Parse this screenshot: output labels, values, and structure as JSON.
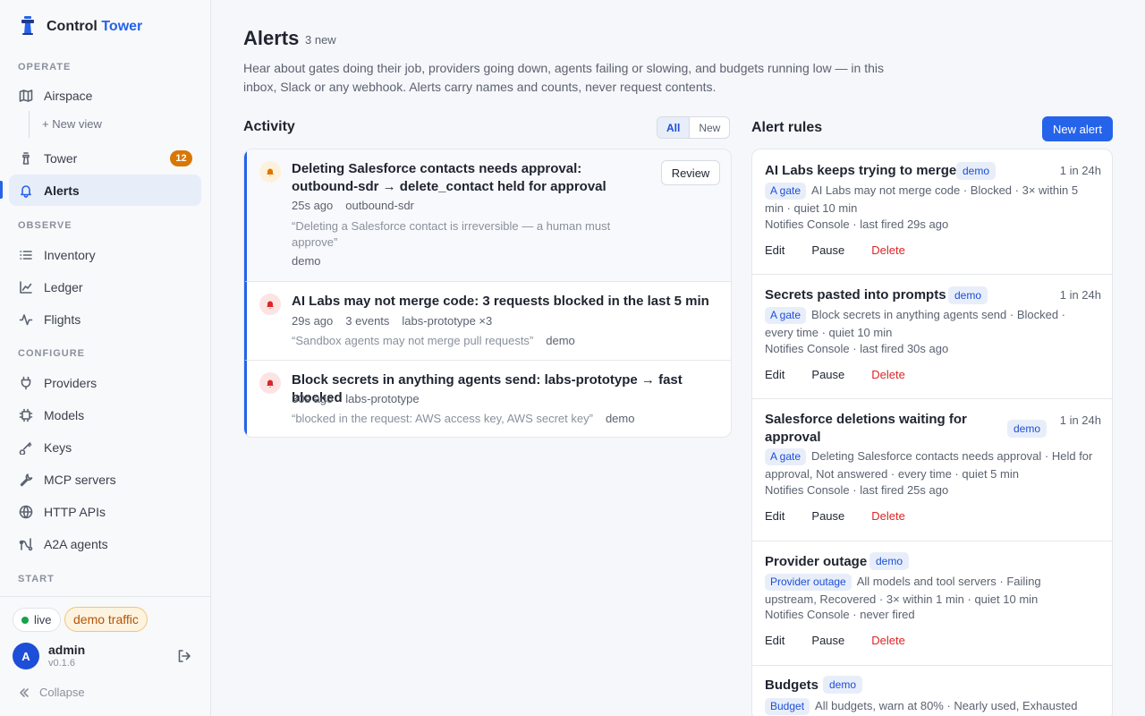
{
  "brand": {
    "name_a": "Control",
    "name_b": "Tower"
  },
  "sidebar": {
    "sections": {
      "operate": "OPERATE",
      "observe": "OBSERVE",
      "configure": "CONFIGURE",
      "start": "START"
    },
    "items": {
      "airspace": "Airspace",
      "new_view": "+ New view",
      "tower": "Tower",
      "tower_count": "12",
      "alerts": "Alerts",
      "inventory": "Inventory",
      "ledger": "Ledger",
      "flights": "Flights",
      "providers": "Providers",
      "models": "Models",
      "keys": "Keys",
      "mcp_servers": "MCP servers",
      "http_apis": "HTTP APIs",
      "a2a_agents": "A2A agents"
    },
    "status": {
      "live": "live",
      "demo": "demo traffic"
    },
    "user": {
      "initial": "A",
      "name": "admin",
      "version": "v0.1.6"
    },
    "collapse": "Collapse"
  },
  "page": {
    "title": "Alerts",
    "subtitle": "3 new",
    "description": "Hear about gates doing their job, providers going down, agents failing or slowing, and budgets running low — in this inbox, Slack or any webhook. Alerts carry names and counts, never request contents."
  },
  "activity": {
    "heading": "Activity",
    "filters": [
      "All",
      "New"
    ],
    "items": [
      {
        "title": "Deleting Salesforce contacts needs approval: outbound-sdr → delete_contact held for approval",
        "time": "25s ago",
        "meta": [
          "outbound-sdr"
        ],
        "quote": "“Deleting a Salesforce contact is irreversible — a human must approve”",
        "tag": "demo",
        "action": "Review",
        "severity_color": "#d97706"
      },
      {
        "title": "AI Labs may not merge code: 3 requests blocked in the last 5 min",
        "time": "29s ago",
        "meta": [
          "3 events",
          "labs-prototype ×3"
        ],
        "quote": "“Sandbox agents may not merge pull requests”",
        "tag": "demo",
        "severity_color": "#dc2626"
      },
      {
        "title": "Block secrets in anything agents send: labs-prototype → fast blocked",
        "time": "30s ago",
        "meta": [
          "labs-prototype"
        ],
        "quote": "“blocked in the request: AWS access key, AWS secret key”",
        "tag": "demo",
        "severity_color": "#dc2626"
      }
    ]
  },
  "rules": {
    "heading": "Alert rules",
    "new_button": "New alert",
    "actions": {
      "edit": "Edit",
      "pause": "Pause",
      "delete": "Delete"
    },
    "items": [
      {
        "name": "AI Labs keeps trying to merge",
        "tag": "demo",
        "freq": "1 in 24h",
        "kind": "A gate",
        "desc": "AI Labs may not merge code · Blocked · 3× within 5 min · quiet 10 min",
        "notify": "Notifies Console · last fired 29s ago"
      },
      {
        "name": "Secrets pasted into prompts",
        "tag": "demo",
        "freq": "1 in 24h",
        "kind": "A gate",
        "desc": "Block secrets in anything agents send · Blocked · every time · quiet 10 min",
        "notify": "Notifies Console · last fired 30s ago"
      },
      {
        "name": "Salesforce deletions waiting for approval",
        "tag": "demo",
        "freq": "1 in 24h",
        "kind": "A gate",
        "desc": "Deleting Salesforce contacts needs approval · Held for approval, Not answered · every time · quiet 5 min",
        "notify": "Notifies Console · last fired 25s ago"
      },
      {
        "name": "Provider outage",
        "tag": "demo",
        "freq": "",
        "kind": "Provider outage",
        "desc": "All models and tool servers · Failing upstream, Recovered · 3× within 1 min · quiet 10 min",
        "notify": "Notifies Console · never fired"
      },
      {
        "name": "Budgets",
        "tag": "demo",
        "freq": "",
        "kind": "Budget",
        "desc": "All budgets, warn at 80% · Nearly used, Exhausted",
        "notify": ""
      }
    ]
  },
  "colors": {
    "accent": "#2563eb",
    "warning": "#d97706",
    "danger": "#dc2626",
    "success": "#16a34a"
  }
}
